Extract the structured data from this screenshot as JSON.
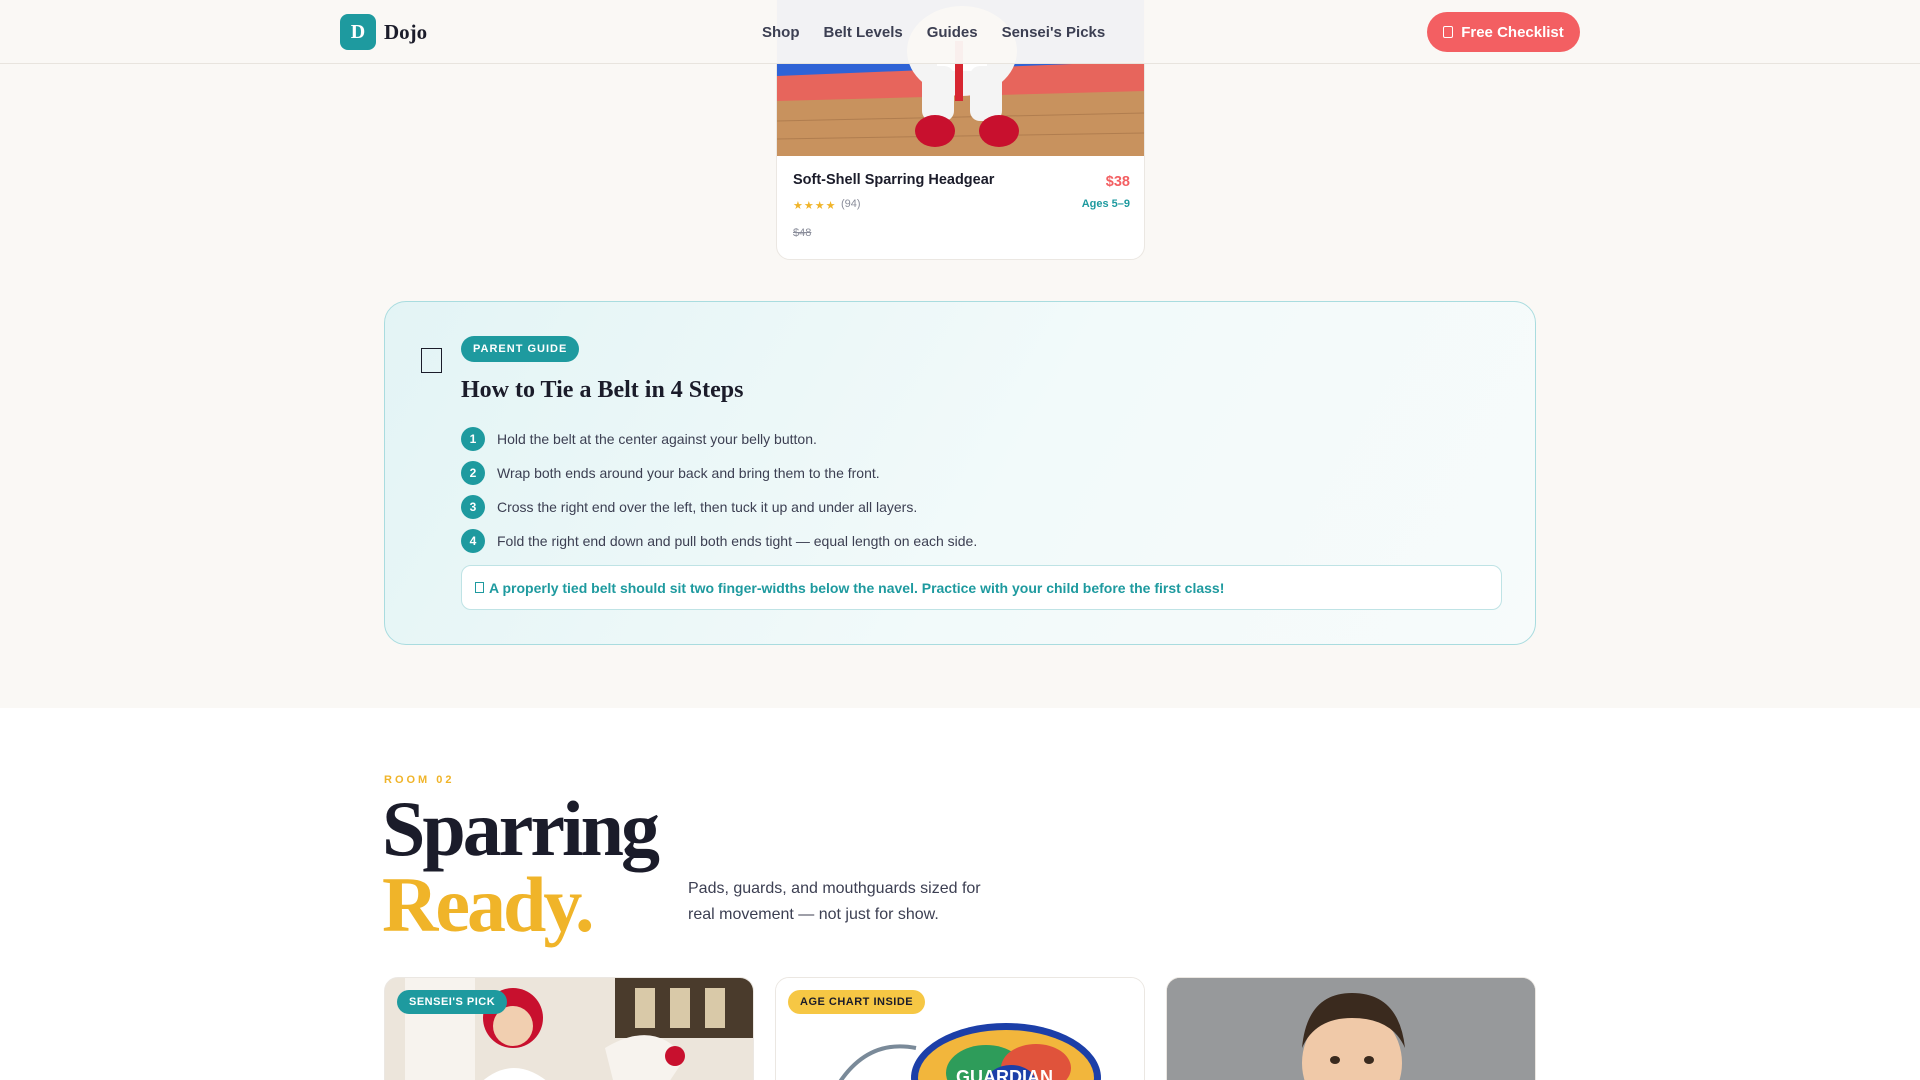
{
  "header": {
    "logo_letter": "D",
    "logo_text": "Dojo",
    "nav": [
      "Shop",
      "Belt Levels",
      "Guides",
      "Sensei's Picks"
    ],
    "cta_label": "Free Checklist"
  },
  "product": {
    "name": "Soft-Shell Sparring Headgear",
    "price": "$38",
    "stars": "★★★★",
    "rating_count": "(94)",
    "age": "Ages 5–9",
    "old_price": "$48"
  },
  "guide": {
    "badge": "PARENT GUIDE",
    "title": "How to Tie a Belt in 4 Steps",
    "steps": [
      {
        "num": "1",
        "text": "Hold the belt at the center against your belly button."
      },
      {
        "num": "2",
        "text": "Wrap both ends around your back and bring them to the front."
      },
      {
        "num": "3",
        "text": "Cross the right end over the left, then tuck it up and under all layers."
      },
      {
        "num": "4",
        "text": "Fold the right end down and pull both ends tight — equal length on each side."
      }
    ],
    "tip": "A properly tied belt should sit two finger-widths below the navel. Practice with your child before the first class!"
  },
  "section2": {
    "eyebrow": "ROOM 02",
    "title_line1": "Sparring",
    "title_line2": "Ready.",
    "description": "Pads, guards, and mouthguards sized for real movement — not just for show.",
    "cards": [
      {
        "badge": "SENSEI'S PICK"
      },
      {
        "badge": "AGE CHART INSIDE",
        "product_text": "GUARDIAN"
      },
      {
        "badge": ""
      }
    ]
  },
  "colors": {
    "accent": "#1e9a9f",
    "cta": "#f35f62",
    "highlight": "#f0b429",
    "ink": "#1b1c2a"
  }
}
